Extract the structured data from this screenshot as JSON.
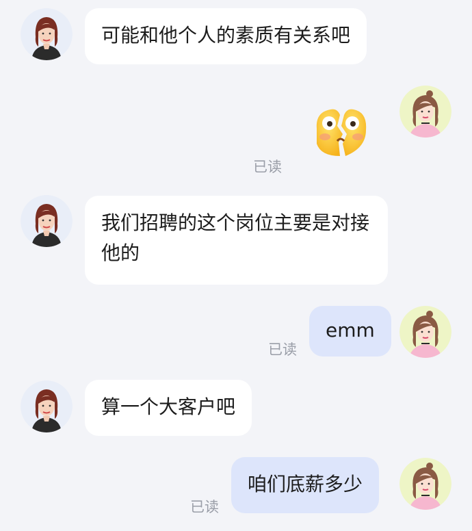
{
  "chat": {
    "messages": [
      {
        "sender": "them",
        "type": "text",
        "text": "可能和他个人的素质有关系吧"
      },
      {
        "sender": "me",
        "type": "sticker",
        "sticker": "broken-heart-shocked-face",
        "status": "已读"
      },
      {
        "sender": "them",
        "type": "text",
        "text": "我们招聘的这个岗位主要是对接他的"
      },
      {
        "sender": "me",
        "type": "text",
        "text": "emm",
        "status": "已读"
      },
      {
        "sender": "them",
        "type": "text",
        "text": "算一个大客户吧"
      },
      {
        "sender": "me",
        "type": "text",
        "text": "咱们底薪多少",
        "status": "已读"
      }
    ]
  },
  "colors": {
    "background": "#f3f4f8",
    "incoming_bubble": "#ffffff",
    "outgoing_bubble": "#dde5fb",
    "read_status": "#9a9ea8"
  }
}
